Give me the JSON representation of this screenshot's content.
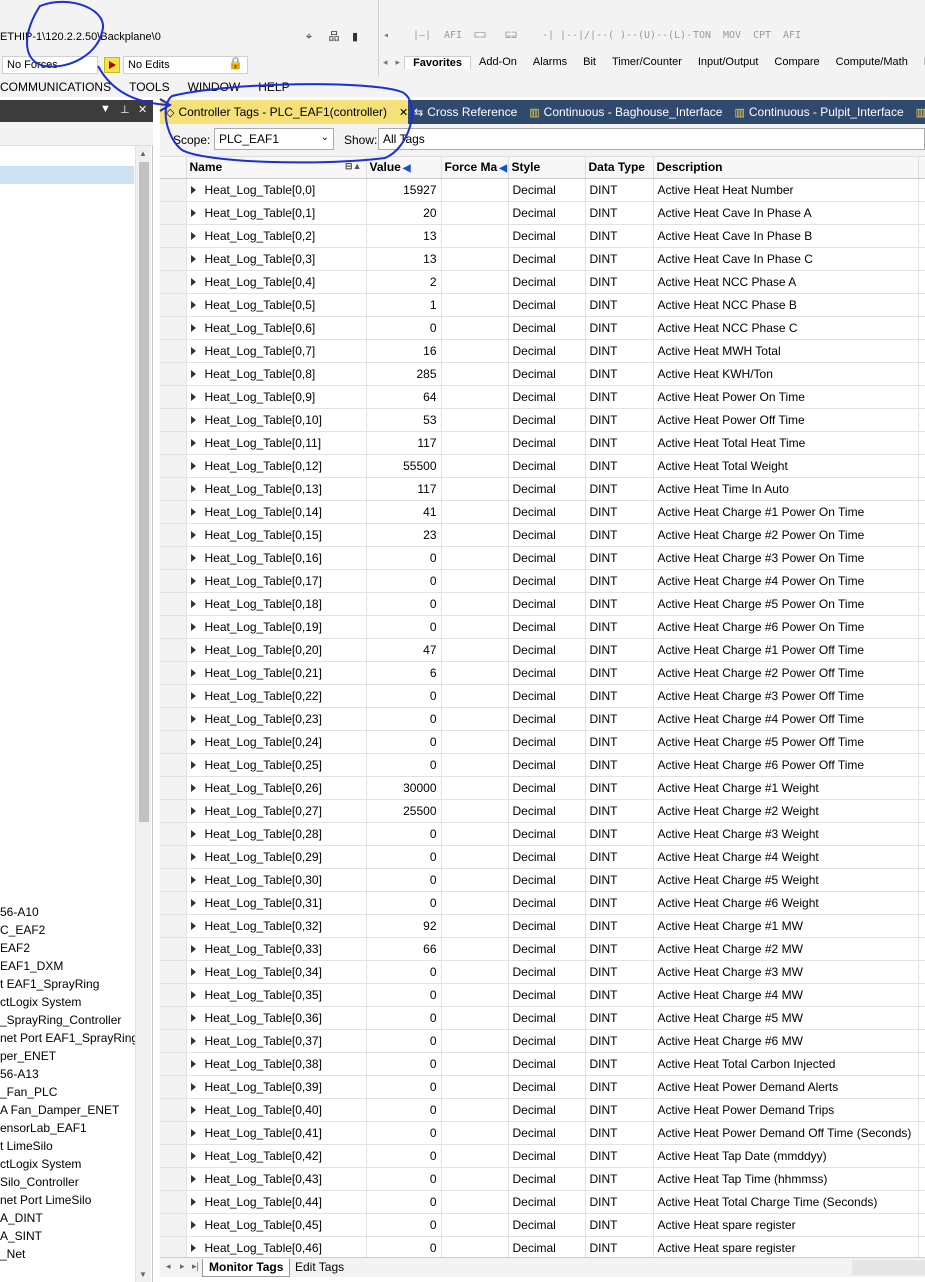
{
  "toolbar": {
    "path": "ETHIP-1\\120.2.2.50\\Backplane\\0",
    "forces": "No Forces",
    "edits": "No Edits"
  },
  "instructions": [
    "AFI",
    "-| |-",
    "-|/|-",
    "-( )-",
    "-(U)-",
    "-(L)-",
    "TON",
    "MOV",
    "CPT",
    "AFI"
  ],
  "fav_tabs": [
    "Favorites",
    "Add-On",
    "Alarms",
    "Bit",
    "Timer/Counter",
    "Input/Output",
    "Compare",
    "Compute/Math",
    "M"
  ],
  "menu": [
    "COMMUNICATIONS",
    "TOOLS",
    "WINDOW",
    "HELP"
  ],
  "tree_items": [
    "56-A10",
    "C_EAF2",
    "EAF2",
    "EAF1_DXM",
    "t EAF1_SprayRing",
    "ctLogix System",
    "_SprayRing_Controller",
    "net Port EAF1_SprayRing",
    "per_ENET",
    "56-A13",
    "_Fan_PLC",
    "A Fan_Damper_ENET",
    "ensorLab_EAF1",
    "t LimeSilo",
    "ctLogix System",
    "Silo_Controller",
    "net Port LimeSilo",
    "A_DINT",
    "A_SINT",
    "_Net"
  ],
  "doc_tabs": [
    {
      "label": "Controller Tags - PLC_EAF1(controller)",
      "close": "✕"
    },
    {
      "label": "Cross Reference"
    },
    {
      "label": "Continuous - Baghouse_Interface"
    },
    {
      "label": "Continuous - Pulpit_Interface"
    }
  ],
  "scope": {
    "label": "Scope:",
    "value": "PLC_EAF1",
    "show_label": "Show:",
    "show_value": "All Tags"
  },
  "columns": {
    "name": "Name",
    "value": "Value",
    "force": "Force Ma",
    "style": "Style",
    "dtype": "Data Type",
    "desc": "Description"
  },
  "rows": [
    {
      "n": "Heat_Log_Table[0,0]",
      "v": "15927",
      "s": "Decimal",
      "t": "DINT",
      "d": "Active Heat Heat Number"
    },
    {
      "n": "Heat_Log_Table[0,1]",
      "v": "20",
      "s": "Decimal",
      "t": "DINT",
      "d": "Active Heat Cave In Phase A"
    },
    {
      "n": "Heat_Log_Table[0,2]",
      "v": "13",
      "s": "Decimal",
      "t": "DINT",
      "d": "Active Heat Cave In Phase B"
    },
    {
      "n": "Heat_Log_Table[0,3]",
      "v": "13",
      "s": "Decimal",
      "t": "DINT",
      "d": "Active Heat Cave In Phase C"
    },
    {
      "n": "Heat_Log_Table[0,4]",
      "v": "2",
      "s": "Decimal",
      "t": "DINT",
      "d": "Active Heat NCC Phase A"
    },
    {
      "n": "Heat_Log_Table[0,5]",
      "v": "1",
      "s": "Decimal",
      "t": "DINT",
      "d": "Active Heat NCC Phase B"
    },
    {
      "n": "Heat_Log_Table[0,6]",
      "v": "0",
      "s": "Decimal",
      "t": "DINT",
      "d": "Active Heat NCC Phase C"
    },
    {
      "n": "Heat_Log_Table[0,7]",
      "v": "16",
      "s": "Decimal",
      "t": "DINT",
      "d": "Active Heat MWH Total"
    },
    {
      "n": "Heat_Log_Table[0,8]",
      "v": "285",
      "s": "Decimal",
      "t": "DINT",
      "d": "Active Heat KWH/Ton"
    },
    {
      "n": "Heat_Log_Table[0,9]",
      "v": "64",
      "s": "Decimal",
      "t": "DINT",
      "d": "Active Heat Power On Time"
    },
    {
      "n": "Heat_Log_Table[0,10]",
      "v": "53",
      "s": "Decimal",
      "t": "DINT",
      "d": "Active Heat Power Off Time"
    },
    {
      "n": "Heat_Log_Table[0,11]",
      "v": "117",
      "s": "Decimal",
      "t": "DINT",
      "d": "Active Heat Total Heat Time"
    },
    {
      "n": "Heat_Log_Table[0,12]",
      "v": "55500",
      "s": "Decimal",
      "t": "DINT",
      "d": "Active Heat Total Weight"
    },
    {
      "n": "Heat_Log_Table[0,13]",
      "v": "117",
      "s": "Decimal",
      "t": "DINT",
      "d": "Active Heat Time In Auto"
    },
    {
      "n": "Heat_Log_Table[0,14]",
      "v": "41",
      "s": "Decimal",
      "t": "DINT",
      "d": "Active Heat Charge #1 Power On Time"
    },
    {
      "n": "Heat_Log_Table[0,15]",
      "v": "23",
      "s": "Decimal",
      "t": "DINT",
      "d": "Active Heat Charge #2 Power On Time"
    },
    {
      "n": "Heat_Log_Table[0,16]",
      "v": "0",
      "s": "Decimal",
      "t": "DINT",
      "d": "Active Heat Charge #3 Power On Time"
    },
    {
      "n": "Heat_Log_Table[0,17]",
      "v": "0",
      "s": "Decimal",
      "t": "DINT",
      "d": "Active Heat Charge #4 Power On Time"
    },
    {
      "n": "Heat_Log_Table[0,18]",
      "v": "0",
      "s": "Decimal",
      "t": "DINT",
      "d": "Active Heat Charge #5 Power On Time"
    },
    {
      "n": "Heat_Log_Table[0,19]",
      "v": "0",
      "s": "Decimal",
      "t": "DINT",
      "d": "Active Heat Charge #6 Power On Time"
    },
    {
      "n": "Heat_Log_Table[0,20]",
      "v": "47",
      "s": "Decimal",
      "t": "DINT",
      "d": "Active Heat Charge #1 Power Off Time"
    },
    {
      "n": "Heat_Log_Table[0,21]",
      "v": "6",
      "s": "Decimal",
      "t": "DINT",
      "d": "Active Heat Charge #2 Power Off Time"
    },
    {
      "n": "Heat_Log_Table[0,22]",
      "v": "0",
      "s": "Decimal",
      "t": "DINT",
      "d": "Active Heat Charge #3 Power Off Time"
    },
    {
      "n": "Heat_Log_Table[0,23]",
      "v": "0",
      "s": "Decimal",
      "t": "DINT",
      "d": "Active Heat Charge #4 Power Off Time"
    },
    {
      "n": "Heat_Log_Table[0,24]",
      "v": "0",
      "s": "Decimal",
      "t": "DINT",
      "d": "Active Heat Charge #5 Power Off Time"
    },
    {
      "n": "Heat_Log_Table[0,25]",
      "v": "0",
      "s": "Decimal",
      "t": "DINT",
      "d": "Active Heat Charge #6 Power Off Time"
    },
    {
      "n": "Heat_Log_Table[0,26]",
      "v": "30000",
      "s": "Decimal",
      "t": "DINT",
      "d": "Active Heat Charge #1 Weight"
    },
    {
      "n": "Heat_Log_Table[0,27]",
      "v": "25500",
      "s": "Decimal",
      "t": "DINT",
      "d": "Active Heat Charge #2 Weight"
    },
    {
      "n": "Heat_Log_Table[0,28]",
      "v": "0",
      "s": "Decimal",
      "t": "DINT",
      "d": "Active Heat Charge #3 Weight"
    },
    {
      "n": "Heat_Log_Table[0,29]",
      "v": "0",
      "s": "Decimal",
      "t": "DINT",
      "d": "Active Heat Charge #4 Weight"
    },
    {
      "n": "Heat_Log_Table[0,30]",
      "v": "0",
      "s": "Decimal",
      "t": "DINT",
      "d": "Active Heat Charge #5 Weight"
    },
    {
      "n": "Heat_Log_Table[0,31]",
      "v": "0",
      "s": "Decimal",
      "t": "DINT",
      "d": "Active Heat Charge #6 Weight"
    },
    {
      "n": "Heat_Log_Table[0,32]",
      "v": "92",
      "s": "Decimal",
      "t": "DINT",
      "d": "Active Heat Charge #1 MW"
    },
    {
      "n": "Heat_Log_Table[0,33]",
      "v": "66",
      "s": "Decimal",
      "t": "DINT",
      "d": "Active Heat Charge #2 MW"
    },
    {
      "n": "Heat_Log_Table[0,34]",
      "v": "0",
      "s": "Decimal",
      "t": "DINT",
      "d": "Active Heat Charge #3 MW"
    },
    {
      "n": "Heat_Log_Table[0,35]",
      "v": "0",
      "s": "Decimal",
      "t": "DINT",
      "d": "Active Heat Charge #4 MW"
    },
    {
      "n": "Heat_Log_Table[0,36]",
      "v": "0",
      "s": "Decimal",
      "t": "DINT",
      "d": "Active Heat Charge #5 MW"
    },
    {
      "n": "Heat_Log_Table[0,37]",
      "v": "0",
      "s": "Decimal",
      "t": "DINT",
      "d": "Active Heat Charge #6 MW"
    },
    {
      "n": "Heat_Log_Table[0,38]",
      "v": "0",
      "s": "Decimal",
      "t": "DINT",
      "d": "Active Heat Total Carbon Injected"
    },
    {
      "n": "Heat_Log_Table[0,39]",
      "v": "0",
      "s": "Decimal",
      "t": "DINT",
      "d": "Active Heat Power Demand Alerts"
    },
    {
      "n": "Heat_Log_Table[0,40]",
      "v": "0",
      "s": "Decimal",
      "t": "DINT",
      "d": "Active Heat Power Demand Trips"
    },
    {
      "n": "Heat_Log_Table[0,41]",
      "v": "0",
      "s": "Decimal",
      "t": "DINT",
      "d": "Active Heat Power Demand Off Time (Seconds)"
    },
    {
      "n": "Heat_Log_Table[0,42]",
      "v": "0",
      "s": "Decimal",
      "t": "DINT",
      "d": "Active Heat Tap Date (mmddyy)"
    },
    {
      "n": "Heat_Log_Table[0,43]",
      "v": "0",
      "s": "Decimal",
      "t": "DINT",
      "d": "Active Heat Tap Time (hhmmss)"
    },
    {
      "n": "Heat_Log_Table[0,44]",
      "v": "0",
      "s": "Decimal",
      "t": "DINT",
      "d": "Active Heat Total Charge Time (Seconds)"
    },
    {
      "n": "Heat_Log_Table[0,45]",
      "v": "0",
      "s": "Decimal",
      "t": "DINT",
      "d": "Active Heat spare register"
    },
    {
      "n": "Heat_Log_Table[0,46]",
      "v": "0",
      "s": "Decimal",
      "t": "DINT",
      "d": "Active Heat spare register"
    }
  ],
  "bottom_tabs": [
    "Monitor Tags",
    "Edit Tags"
  ],
  "colors": {
    "doc_tabs_bg": "#2f4a6e",
    "active_tab": "#f5e07a",
    "annotation": "#1a2fd6"
  }
}
